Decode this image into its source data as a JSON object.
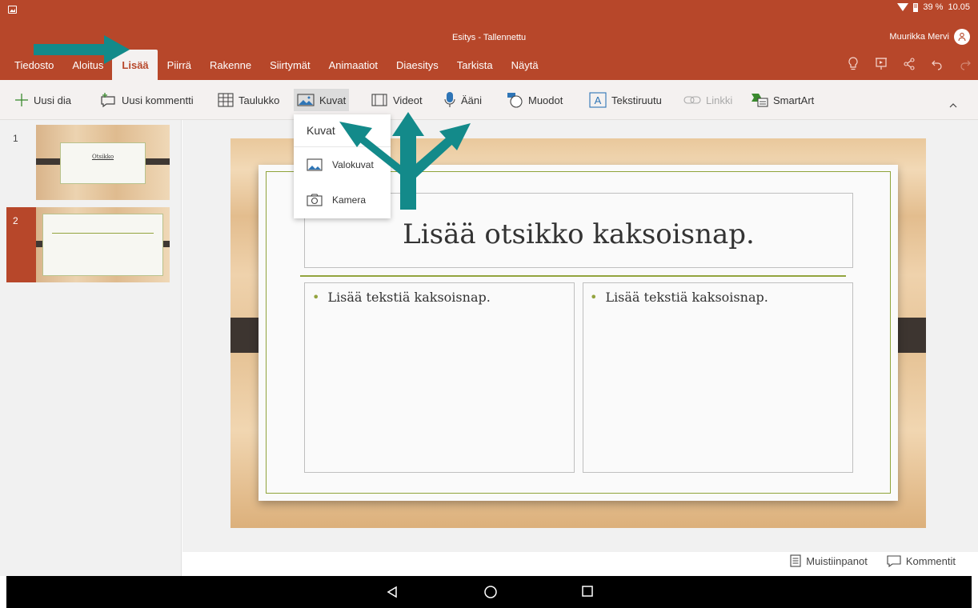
{
  "status_bar": {
    "battery": "39 %",
    "time": "10.05"
  },
  "document": {
    "title": "Esitys - Tallennettu",
    "user": "Muurikka Mervi"
  },
  "tabs": [
    "Tiedosto",
    "Aloitus",
    "Lisää",
    "Piirrä",
    "Rakenne",
    "Siirtymät",
    "Animaatiot",
    "Diaesitys",
    "Tarkista",
    "Näytä"
  ],
  "active_tab": "Lisää",
  "tab_icons": [
    "lightbulb-icon",
    "present-icon",
    "share-icon",
    "undo-icon",
    "redo-icon"
  ],
  "ribbon": {
    "uusi_dia": "Uusi dia",
    "uusi_kommentti": "Uusi kommentti",
    "taulukko": "Taulukko",
    "kuvat": "Kuvat",
    "videot": "Videot",
    "aani": "Ääni",
    "muodot": "Muodot",
    "tekstiruutu": "Tekstiruutu",
    "linkki": "Linkki",
    "smartart": "SmartArt"
  },
  "dropdown": {
    "title": "Kuvat",
    "items": [
      "Valokuvat",
      "Kamera"
    ]
  },
  "thumbnails": [
    {
      "number": "1",
      "title": "Otsikko"
    },
    {
      "number": "2"
    }
  ],
  "slide": {
    "title": "Lisää otsikko kaksoisnap.",
    "left_body": "Lisää tekstiä kaksoisnap.",
    "right_body": "Lisää tekstiä kaksoisnap."
  },
  "bottom": {
    "notes": "Muistiinpanot",
    "comments": "Kommentit"
  },
  "colors": {
    "accent": "#b7472a",
    "annotation_arrow": "#138a8a",
    "slide_line": "#93a43f"
  }
}
